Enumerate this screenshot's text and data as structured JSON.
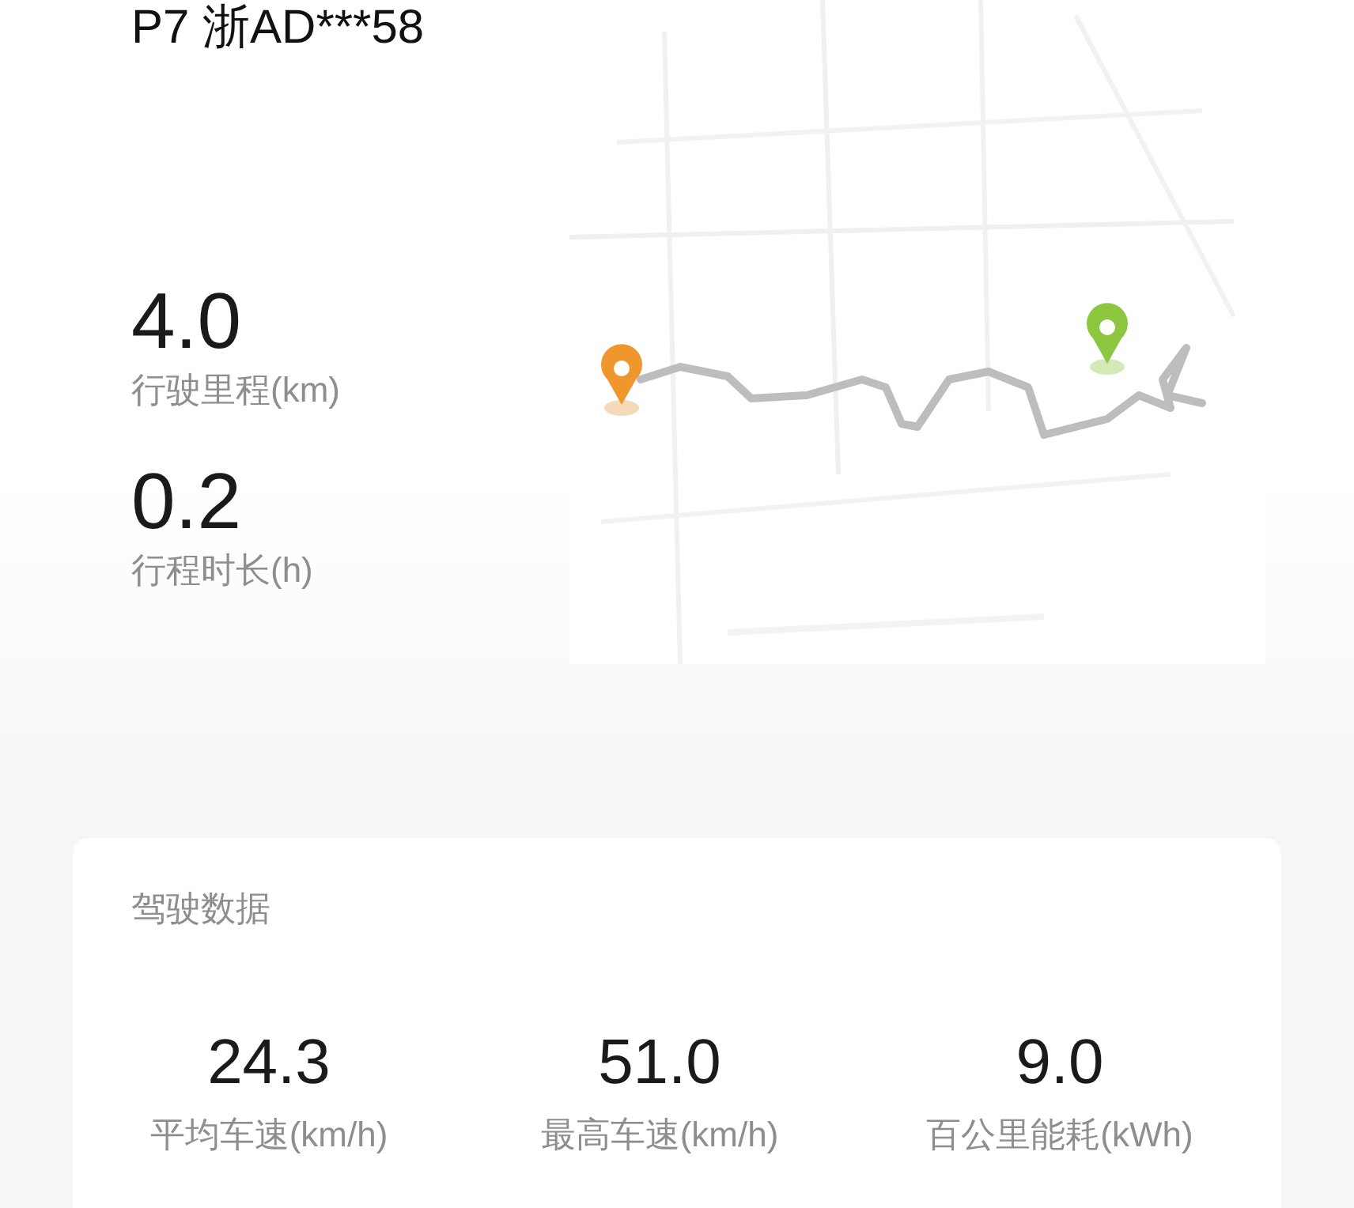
{
  "title": "P7 浙AD***58",
  "trip_stats": [
    {
      "value": "4.0",
      "label": "行驶里程(km)"
    },
    {
      "value": "0.2",
      "label": "行程时长(h)"
    }
  ],
  "driving_data": {
    "title": "驾驶数据",
    "metrics": [
      {
        "value": "24.3",
        "label": "平均车速(km/h)"
      },
      {
        "value": "51.0",
        "label": "最高车速(km/h)"
      },
      {
        "value": "9.0",
        "label": "百公里能耗(kWh)"
      }
    ]
  }
}
